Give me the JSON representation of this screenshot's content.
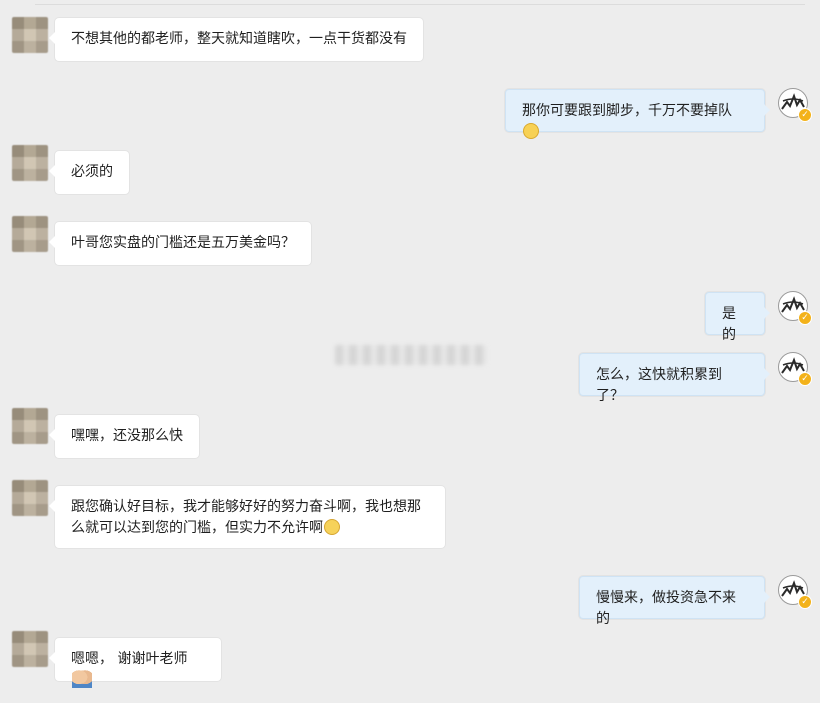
{
  "chat": {
    "messages": [
      {
        "side": "left",
        "text": "不想其他的都老师，整天就知道瞎吹，一点干货都没有",
        "emoji": null
      },
      {
        "side": "right",
        "text": "那你可要跟到脚步，千万不要掉队",
        "emoji": "sweat-smile-icon"
      },
      {
        "side": "left",
        "text": "必须的",
        "emoji": null
      },
      {
        "side": "left",
        "text": "叶哥您实盘的门槛还是五万美金吗？",
        "emoji": null
      },
      {
        "side": "right",
        "text": "是的",
        "emoji": null
      },
      {
        "side": "right",
        "text": "怎么，这快就积累到了？",
        "emoji": null
      },
      {
        "side": "left",
        "text": "嘿嘿，还没那么快",
        "emoji": null
      },
      {
        "side": "left",
        "text": "跟您确认好目标，我才能够好好的努力奋斗啊，我也想那么就可以达到您的门槛，但实力不允许啊",
        "emoji": "flushed-face-icon"
      },
      {
        "side": "right",
        "text": "慢慢来，做投资急不来的",
        "emoji": null
      },
      {
        "side": "left",
        "text": "嗯嗯， 谢谢叶老师",
        "emoji": "folded-hands-icon"
      }
    ]
  },
  "colors": {
    "background": "#ededed",
    "left_bubble": "#ffffff",
    "right_bubble": "#e3f0fb",
    "verified_badge": "#f3b21a"
  }
}
